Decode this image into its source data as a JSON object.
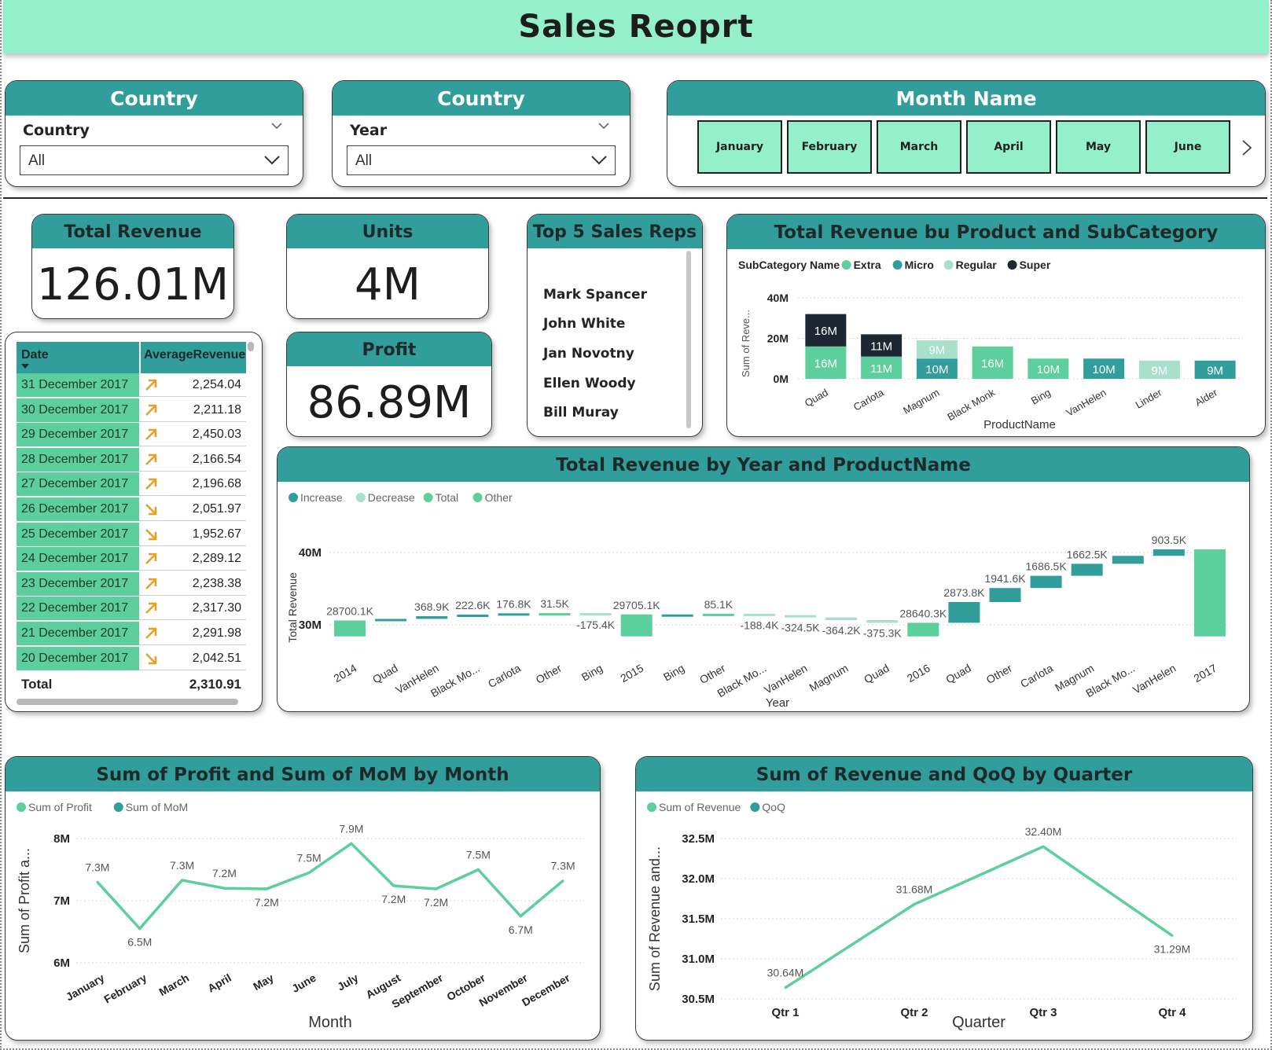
{
  "report": {
    "title": "Sales Reoprt"
  },
  "slicers": {
    "country": {
      "header": "Country",
      "label": "Country",
      "value": "All"
    },
    "year": {
      "header": "Country",
      "label": "Year",
      "value": "All"
    },
    "month": {
      "header": "Month Name",
      "buttons": [
        "January",
        "February",
        "March",
        "April",
        "May",
        "June"
      ]
    }
  },
  "kpis": {
    "total_revenue": {
      "title": "Total Revenue",
      "value": "126.01M"
    },
    "units": {
      "title": "Units",
      "value": "4M"
    },
    "profit": {
      "title": "Profit",
      "value": "86.89M"
    }
  },
  "top_reps": {
    "title": "Top 5 Sales Reps",
    "names": [
      "Mark Spancer",
      "John White",
      "Jan Novotny",
      "Ellen Woody",
      "Bill Muray"
    ]
  },
  "avg_table": {
    "headers": {
      "date": "Date",
      "value": "AverageRevenue"
    },
    "rows": [
      {
        "date": "31 December 2017",
        "trend": "up",
        "value": "2,254.04"
      },
      {
        "date": "30 December 2017",
        "trend": "up",
        "value": "2,211.18"
      },
      {
        "date": "29 December 2017",
        "trend": "up",
        "value": "2,450.03"
      },
      {
        "date": "28 December 2017",
        "trend": "up",
        "value": "2,166.54"
      },
      {
        "date": "27 December 2017",
        "trend": "up",
        "value": "2,196.68"
      },
      {
        "date": "26 December 2017",
        "trend": "down",
        "value": "2,051.97"
      },
      {
        "date": "25 December 2017",
        "trend": "down",
        "value": "1,952.67"
      },
      {
        "date": "24 December 2017",
        "trend": "up",
        "value": "2,289.12"
      },
      {
        "date": "23 December 2017",
        "trend": "up",
        "value": "2,238.38"
      },
      {
        "date": "22 December 2017",
        "trend": "up",
        "value": "2,317.30"
      },
      {
        "date": "21 December 2017",
        "trend": "up",
        "value": "2,291.98"
      },
      {
        "date": "20 December 2017",
        "trend": "down",
        "value": "2,042.51"
      }
    ],
    "total_label": "Total",
    "total_value": "2,310.91",
    "arrow_color": "#e8a020"
  },
  "colors": {
    "teal_header": "#329e9b",
    "mint": "#94f0cb",
    "extra": "#5ccf9c",
    "micro": "#329e9b",
    "regular": "#a8e0cc",
    "super": "#1c2733",
    "line": "#5ccf9c"
  },
  "chart_data": [
    {
      "id": "subcategory",
      "type": "bar",
      "title": "Total Revenue bu Product and SubCategory",
      "legend_title": "SubCategory Name",
      "legend": [
        "Extra",
        "Micro",
        "Regular",
        "Super"
      ],
      "xlabel": "ProductName",
      "ylabel": "Sum of Reve...",
      "yticks": [
        "40M",
        "20M",
        "0M"
      ],
      "ylim": [
        0,
        40
      ],
      "categories": [
        "Quad",
        "Carlota",
        "Magnum",
        "Black Monk",
        "Bing",
        "VanHelen",
        "Linder",
        "Alder"
      ],
      "stacks": [
        [
          {
            "series": "Extra",
            "value": 16,
            "label": "16M"
          },
          {
            "series": "Super",
            "value": 16,
            "label": "16M"
          }
        ],
        [
          {
            "series": "Extra",
            "value": 11,
            "label": "11M"
          },
          {
            "series": "Super",
            "value": 11,
            "label": "11M"
          }
        ],
        [
          {
            "series": "Micro",
            "value": 10,
            "label": "10M"
          },
          {
            "series": "Regular",
            "value": 9,
            "label": "9M"
          }
        ],
        [
          {
            "series": "Extra",
            "value": 16,
            "label": "16M"
          }
        ],
        [
          {
            "series": "Extra",
            "value": 10,
            "label": "10M"
          }
        ],
        [
          {
            "series": "Micro",
            "value": 10,
            "label": "10M"
          }
        ],
        [
          {
            "series": "Regular",
            "value": 9,
            "label": "9M"
          }
        ],
        [
          {
            "series": "Micro",
            "value": 9,
            "label": "9M"
          }
        ]
      ]
    },
    {
      "id": "waterfall",
      "type": "bar",
      "subtype": "waterfall",
      "title": "Total Revenue by Year and ProductName",
      "legend": [
        "Increase",
        "Decrease",
        "Total",
        "Other"
      ],
      "xlabel": "Year",
      "ylabel": "Total Revenue",
      "yticks": [
        "40M",
        "30M"
      ],
      "categories": [
        "2014",
        "Quad",
        "VanHelen",
        "Black Mo...",
        "Carlota",
        "Other",
        "Bing",
        "2015",
        "Bing",
        "Other",
        "Black Mo...",
        "VanHelen",
        "Magnum",
        "Quad",
        "2016",
        "Quad",
        "Other",
        "Carlota",
        "Magnum",
        "Black Mo...",
        "VanHelen",
        "2017"
      ],
      "steps": [
        {
          "kind": "Total",
          "start": 27.0,
          "end": 30.6,
          "label": "28700.1K"
        },
        {
          "kind": "Increase",
          "start": 30.6,
          "end": 30.82,
          "label": ""
        },
        {
          "kind": "Increase",
          "start": 30.82,
          "end": 31.19,
          "label": "368.9K"
        },
        {
          "kind": "Increase",
          "start": 31.19,
          "end": 31.41,
          "label": "222.6K"
        },
        {
          "kind": "Increase",
          "start": 31.41,
          "end": 31.59,
          "label": "176.8K"
        },
        {
          "kind": "Other",
          "start": 31.59,
          "end": 31.62,
          "label": "31.5K"
        },
        {
          "kind": "Decrease",
          "start": 31.62,
          "end": 31.44,
          "label": "-175.4K"
        },
        {
          "kind": "Total",
          "start": 27.0,
          "end": 31.44,
          "label": "29705.1K"
        },
        {
          "kind": "Increase",
          "start": 31.44,
          "end": 31.44,
          "label": ""
        },
        {
          "kind": "Other",
          "start": 31.44,
          "end": 31.53,
          "label": "85.1K"
        },
        {
          "kind": "Decrease",
          "start": 31.53,
          "end": 31.34,
          "label": "-188.4K"
        },
        {
          "kind": "Decrease",
          "start": 31.34,
          "end": 31.02,
          "label": "-324.5K"
        },
        {
          "kind": "Decrease",
          "start": 31.02,
          "end": 30.65,
          "label": "-364.2K"
        },
        {
          "kind": "Decrease",
          "start": 30.65,
          "end": 30.28,
          "label": "-375.3K"
        },
        {
          "kind": "Total",
          "start": 27.0,
          "end": 30.28,
          "label": "28640.3K"
        },
        {
          "kind": "Increase",
          "start": 30.28,
          "end": 33.15,
          "label": "2873.8K"
        },
        {
          "kind": "Increase",
          "start": 33.15,
          "end": 35.09,
          "label": "1941.6K"
        },
        {
          "kind": "Increase",
          "start": 35.09,
          "end": 36.78,
          "label": "1686.5K"
        },
        {
          "kind": "Increase",
          "start": 36.78,
          "end": 38.44,
          "label": "1662.5K"
        },
        {
          "kind": "Increase",
          "start": 38.44,
          "end": 39.54,
          "label": ""
        },
        {
          "kind": "Increase",
          "start": 39.54,
          "end": 40.44,
          "label": "903.5K"
        },
        {
          "kind": "Total",
          "start": 27.0,
          "end": 40.44,
          "label": ""
        }
      ]
    },
    {
      "id": "profit_month",
      "type": "line",
      "title": "Sum of Profit and Sum of MoM by Month",
      "legend": [
        "Sum of Profit",
        "Sum of MoM"
      ],
      "xlabel": "Month",
      "ylabel": "Sum of Profit a...",
      "yticks": [
        "8M",
        "7M",
        "6M"
      ],
      "ylim": [
        6,
        8
      ],
      "categories": [
        "January",
        "February",
        "March",
        "April",
        "May",
        "June",
        "July",
        "August",
        "September",
        "October",
        "November",
        "December"
      ],
      "values": [
        7.3,
        6.55,
        7.33,
        7.2,
        7.19,
        7.45,
        7.92,
        7.24,
        7.19,
        7.5,
        6.75,
        7.32
      ],
      "labels": [
        "7.3M",
        "6.5M",
        "7.3M",
        "7.2M",
        "7.2M",
        "7.5M",
        "7.9M",
        "7.2M",
        "7.2M",
        "7.5M",
        "6.7M",
        "7.3M"
      ]
    },
    {
      "id": "revenue_quarter",
      "type": "line",
      "title": "Sum of Revenue and QoQ by Quarter",
      "legend": [
        "Sum of Revenue",
        "QoQ"
      ],
      "xlabel": "Quarter",
      "ylabel": "Sum of Revenue and...",
      "yticks": [
        "32.5M",
        "32.0M",
        "31.5M",
        "31.0M",
        "30.5M"
      ],
      "ylim": [
        30.5,
        32.5
      ],
      "categories": [
        "Qtr 1",
        "Qtr 2",
        "Qtr 3",
        "Qtr 4"
      ],
      "values": [
        30.64,
        31.68,
        32.4,
        31.29
      ],
      "labels": [
        "30.64M",
        "31.68M",
        "32.40M",
        "31.29M"
      ]
    }
  ]
}
